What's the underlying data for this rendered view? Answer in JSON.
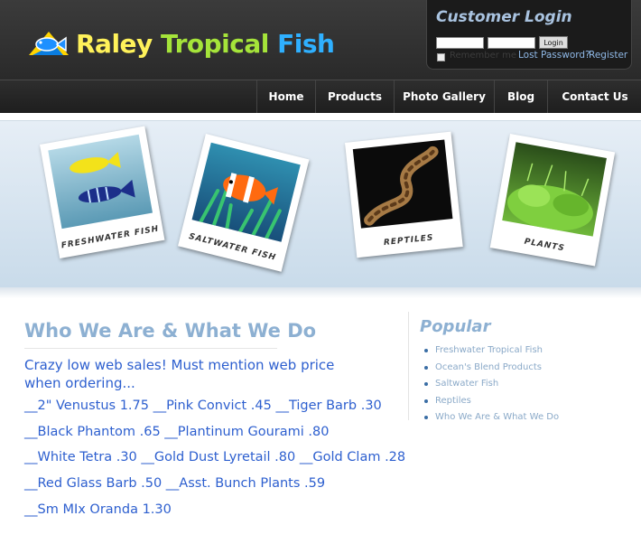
{
  "brand": {
    "word1": "Raley",
    "word2": "Tropical",
    "word3": "Fish",
    "colors": {
      "word1": "#fff25a",
      "word2": "#a5e43a",
      "word3": "#2fb0ff"
    },
    "icon": "fish-logo-icon"
  },
  "login": {
    "title": "Customer Login",
    "button": "Login",
    "remember": "Remember me",
    "lost_password": "Lost Password?",
    "register": "Register"
  },
  "nav": {
    "home": "Home",
    "products": "Products",
    "gallery": "Photo Gallery",
    "blog": "Blog",
    "contact": "Contact Us"
  },
  "banner": {
    "cards": [
      {
        "caption": "FRESHWATER FISH",
        "icon": "freshwater-fish-photo"
      },
      {
        "caption": "SALTWATER FISH",
        "icon": "clownfish-photo"
      },
      {
        "caption": "REPTILES",
        "icon": "snake-photo"
      },
      {
        "caption": "PLANTS",
        "icon": "aquarium-plants-photo"
      }
    ]
  },
  "main": {
    "title": "Who We Are & What We Do",
    "intro": "Crazy low web sales! Must mention web price when ordering...",
    "lines": [
      "__2\" Venustus 1.75 __Pink Convict .45 __Tiger Barb .30",
      "__Black Phantom .65 __Plantinum Gourami .80",
      "__White Tetra .30 __Gold Dust Lyretail .80 __Gold Clam .28",
      "__Red Glass Barb .50 __Asst. Bunch Plants .59",
      "__Sm MIx Oranda 1.30"
    ]
  },
  "sidebar": {
    "title": "Popular",
    "items": [
      "Freshwater Tropical Fish",
      "Ocean's Blend Products",
      "Saltwater Fish",
      "Reptiles",
      "Who We Are & What We Do"
    ]
  }
}
